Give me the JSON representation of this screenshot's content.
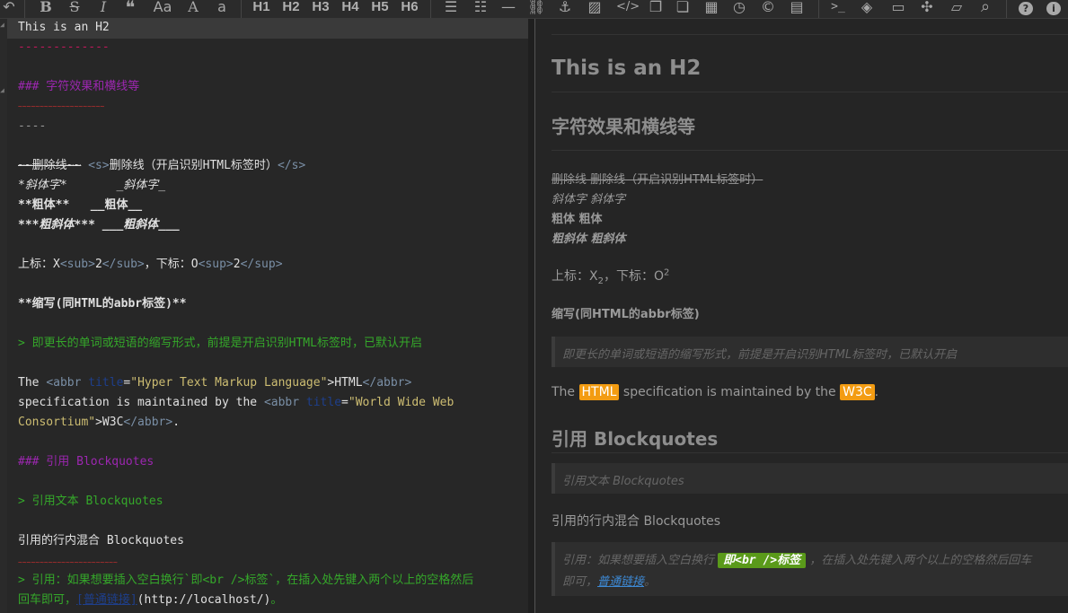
{
  "toolbar": {
    "icons": [
      "undo-icon",
      "bold-icon",
      "strikethrough-icon",
      "italic-icon",
      "quote-icon",
      "aa-icon",
      "uppercase-icon",
      "lowercase-icon",
      "h1",
      "h2",
      "h3",
      "h4",
      "h5",
      "h6",
      "list-ul-icon",
      "list-ol-icon",
      "hr-icon",
      "link-icon",
      "anchor-icon",
      "image-icon",
      "code-icon",
      "preformatted-icon",
      "code-block-icon",
      "table-icon",
      "datetime-icon",
      "emoji-icon",
      "html-entities-icon",
      "goto-line-icon",
      "watch-icon",
      "preview-icon",
      "fullscreen-icon",
      "clear-icon",
      "search-icon",
      "help-icon",
      "info-icon"
    ],
    "glyphs": {
      "undo": "↶",
      "bold": "B",
      "strike": "S",
      "italic": "I",
      "quote": "❝",
      "aa": "Aa",
      "A": "A",
      "a": "a",
      "h1": "H1",
      "h2": "H2",
      "h3": "H3",
      "h4": "H4",
      "h5": "H5",
      "h6": "H6",
      "ul": "☰",
      "ol": "☷",
      "hr": "—",
      "link": "⛓",
      "anchor": "⚓",
      "image": "▨",
      "code": "</>",
      "pre": "❐",
      "codeblock": "❏",
      "table": "▦",
      "time": "◷",
      "emoji": "©",
      "entity": "▤",
      "goto": ">_",
      "watch": "◈",
      "preview": "▭",
      "fullscreen": "✣",
      "clear": "▱",
      "search": "⌕",
      "help": "?",
      "info": "i"
    }
  },
  "editor": {
    "line1": "This is an H2",
    "line2": "-------------",
    "line3": "### 字符效果和横线等",
    "line4": "~~~~~~~~~~~~~~~~~~~~",
    "line5": "----",
    "line6a": "~~删除线~~",
    "line6b": "<s>",
    "line6c": "删除线（开启识别HTML标签时）",
    "line6d": "</s>",
    "line7a": "*斜体字*",
    "line7b": "_斜体字_",
    "line8a": "**粗体**",
    "line8b": "__粗体__",
    "line9a": "***粗斜体***",
    "line9b": "___粗斜体___",
    "line10a": "上标：X",
    "line10b": "<sub>",
    "line10c": "2",
    "line10d": "</sub>",
    "line10e": "，下标：O",
    "line10f": "<sup>",
    "line10g": "2",
    "line10h": "</sup>",
    "line11": "**缩写(同HTML的abbr标签)**",
    "line12": "> 即更长的单词或短语的缩写形式，前提是开启识别HTML标签时，已默认开启",
    "line13a": "The ",
    "line13b": "<abbr ",
    "line13c": "title",
    "line13d": "=",
    "line13e": "\"Hyper Text Markup Language\"",
    "line13f": ">HTML",
    "line13g": "</abbr>",
    "line14a": "specification is maintained by the ",
    "line14b": "<abbr ",
    "line14c": "title",
    "line14d": "=",
    "line14e": "\"World Wide Web",
    "line15a": "Consortium\"",
    "line15b": ">W3C",
    "line15c": "</abbr>",
    "line15d": ".",
    "line16": "### 引用 Blockquotes",
    "line17": "> 引用文本 Blockquotes",
    "line18": "引用的行内混合 Blockquotes",
    "line19": "~~~~~~~~~~~~~~~~~~~~~~~",
    "line20": "> 引用：如果想要插入空白换行`即<br />标签`，在插入处先键入两个以上的空格然后",
    "line21a": "回车即可，",
    "line21b": "[普通链接]",
    "line21c": "(http://localhost/)",
    "line21d": "。"
  },
  "preview": {
    "h2": "This is an H2",
    "h3a": "字符效果和横线等",
    "strike": "删除线 删除线（开启识别HTML标签时）",
    "italic": "斜体字 斜体字",
    "bold": "粗体 粗体",
    "bolditalic": "粗斜体 粗斜体",
    "suptext_a": "上标：X",
    "suptext_b": "2",
    "suptext_c": "，下标：O",
    "suptext_d": "2",
    "abbr_heading": "缩写(同HTML的abbr标签)",
    "bq1": "即更长的单词或短语的缩写形式，前提是开启识别HTML标签时，已默认开启",
    "spec_a": "The ",
    "spec_html": "HTML",
    "spec_b": " specification is maintained by the ",
    "spec_w3c": "W3C",
    "spec_c": ".",
    "h3b": "引用 Blockquotes",
    "bq2": "引用文本 Blockquotes",
    "mixed": "引用的行内混合 Blockquotes",
    "bq3a": "引用：如果想要插入空白换行 ",
    "bq3code": "即<br />标签",
    "bq3b": " ，在插入处先键入两个以上的空格然后回车",
    "bq3c": "即可，",
    "bq3link": "普通链接",
    "bq3d": "。"
  }
}
